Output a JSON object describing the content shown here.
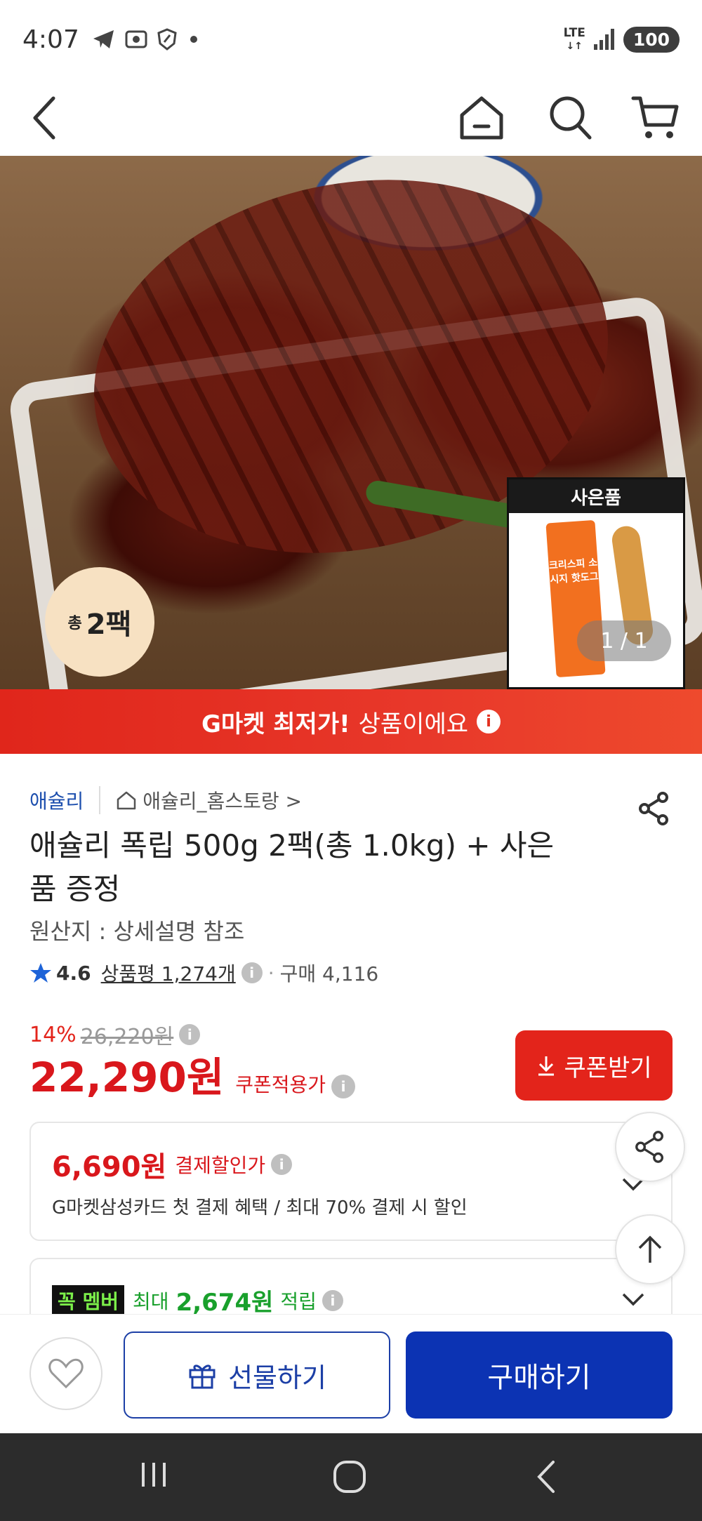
{
  "status_bar": {
    "time": "4:07",
    "network": "LTE",
    "battery": "100"
  },
  "hero": {
    "pack_badge_small": "총",
    "pack_badge_big": "2팩",
    "gift_label": "사은품",
    "gift_package_text": "크리스피 소시지 핫도그",
    "pager": "1 / 1"
  },
  "promo": {
    "strong": "G마켓 최저가!",
    "rest": "상품이에요",
    "info_glyph": "i"
  },
  "product": {
    "brand": "애슐리",
    "store": "애슐리_홈스토랑 >",
    "title": "애슐리 폭립 500g 2팩(총 1.0kg) + 사은품 증정",
    "origin": "원산지 : 상세설명 참조",
    "rating": "4.6",
    "reviews": "상품평 1,274개",
    "purchases": "구매 4,116",
    "discount_pct": "14%",
    "original_price": "26,220원",
    "price": "22,290원",
    "price_label": "쿠폰적용가",
    "coupon_button": "쿠폰받기"
  },
  "card_payment": {
    "amount": "6,690원",
    "label": "결제할인가",
    "description": "G마켓삼성카드 첫 결제 혜택 / 최대 70% 결제 시 할인"
  },
  "card_member": {
    "badge": "꼭 멤버",
    "prefix": "최대",
    "amount": "2,674원",
    "suffix": "적립"
  },
  "action_bar": {
    "gift_button": "선물하기",
    "buy_button": "구매하기"
  },
  "colors": {
    "accent_red": "#e3241b",
    "price_red": "#d9171c",
    "primary_blue": "#0c33b3",
    "brand_blue": "#1d4fae",
    "member_green": "#19a02c"
  }
}
